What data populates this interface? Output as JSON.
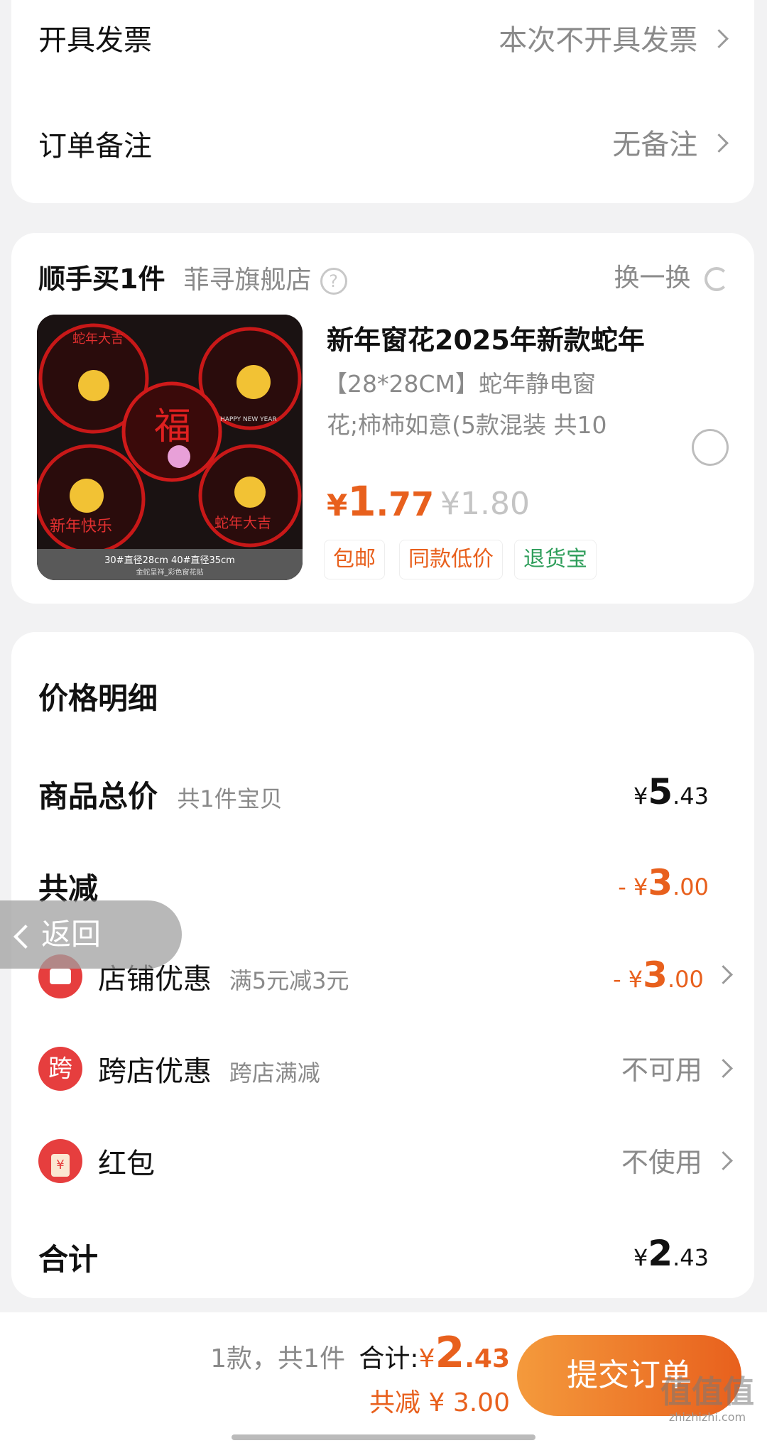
{
  "invoice": {
    "label": "开具发票",
    "value": "本次不开具发票"
  },
  "order_note": {
    "label": "订单备注",
    "value": "无备注"
  },
  "addon": {
    "title": "顺手买1件",
    "store": "菲寻旗舰店",
    "refresh": "换一换",
    "product": {
      "title_line1": "新年窗花2025年新款蛇年",
      "title_line2": "【28*28CM】蛇年静电窗",
      "title_line3": "花;柿柿如意(5款混装 共10",
      "price_symbol": "¥",
      "price_int": "1",
      "price_dec": ".77",
      "original_price": "¥1.80",
      "tags": [
        "包邮",
        "同款低价",
        "退货宝"
      ],
      "image_caption_1": "30#直径28cm 40#直径35cm",
      "image_caption_2": "金蛇呈祥_彩色窗花贴",
      "image_texts": [
        "蛇年大吉",
        "福",
        "新年快乐",
        "蛇年大吉",
        "HAPPY NEW YEAR"
      ]
    }
  },
  "price_detail": {
    "title": "价格明细",
    "goods_total": {
      "label": "商品总价",
      "sub": "共1件宝贝",
      "symbol": "¥",
      "int": "5",
      "dec": ".43"
    },
    "discount": {
      "label": "共减",
      "prefix": "-",
      "symbol": "¥",
      "int": "3",
      "dec": ".00"
    },
    "store_coupon": {
      "label": "店铺优惠",
      "sub": "满5元减3元",
      "prefix": "-",
      "symbol": "¥",
      "int": "3",
      "dec": ".00"
    },
    "cross_store": {
      "icon": "跨",
      "label": "跨店优惠",
      "sub": "跨店满减",
      "value": "不可用"
    },
    "red_packet": {
      "label": "红包",
      "value": "不使用",
      "icon_glyph": "¥"
    },
    "total": {
      "label": "合计",
      "symbol": "¥",
      "int": "2",
      "dec": ".43"
    }
  },
  "back_button": {
    "label": "返回"
  },
  "footer": {
    "count": "1款，共1件",
    "total_label": "合计:",
    "symbol": "¥",
    "int": "2",
    "dec": ".43",
    "saved": "共减 ¥ 3.00",
    "submit": "提交订单",
    "watermark": "值值值",
    "watermark_url": "zhizhizhi.com"
  },
  "colors": {
    "accent": "#e8601d",
    "red": "#e63e3e",
    "green": "#2f9e5b",
    "submit_from": "#f49a3c",
    "submit_to": "#e8601d"
  }
}
